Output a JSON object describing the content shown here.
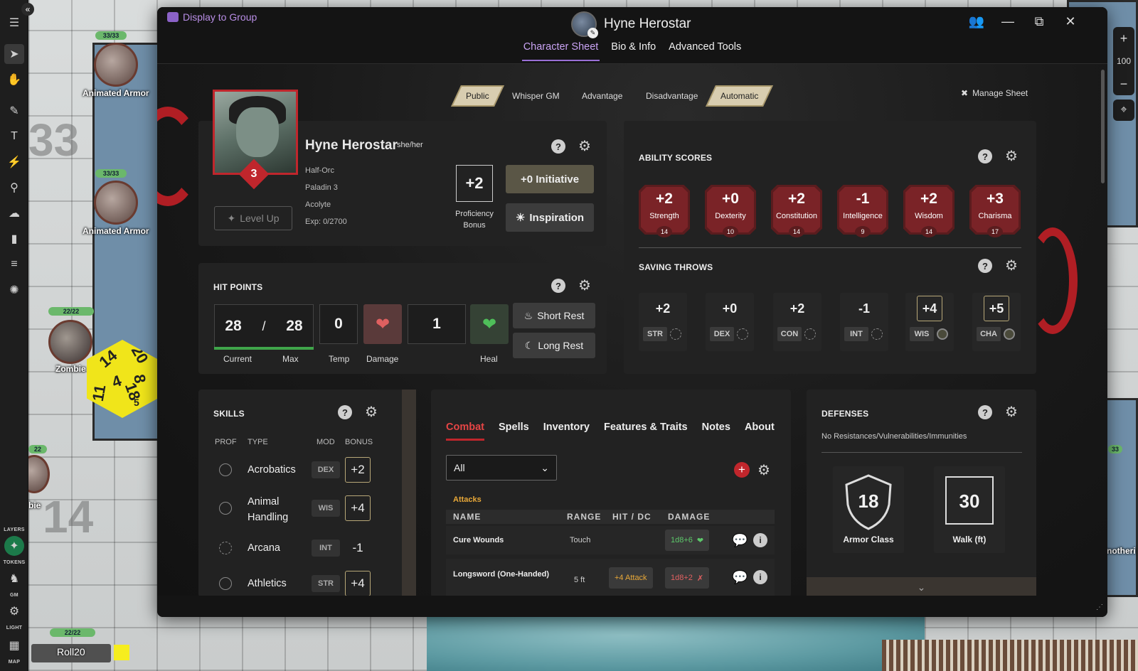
{
  "map": {
    "tokens": [
      {
        "name": "Animated Armor",
        "hp": "33/33"
      },
      {
        "name": "Animated Armor",
        "hp": "33/33"
      },
      {
        "name": "Zombie",
        "hp": "22/22"
      },
      {
        "name": "bie",
        "hp": "22"
      },
      {
        "name": "Roll20",
        "hp": "22/22"
      }
    ],
    "grid_numbers": [
      "33",
      "14"
    ],
    "dice_faces": [
      "14",
      "20",
      "8",
      "18",
      "5",
      "4",
      "11"
    ],
    "right_label": "notheri",
    "right_hp": "33"
  },
  "toolbar": {
    "labels": {
      "layers": "LAYERS",
      "tokens": "TOKENS",
      "gm": "GM",
      "light": "LIGHT",
      "map": "MAP"
    }
  },
  "zoom": {
    "level": "100",
    "plus": "+",
    "minus": "−"
  },
  "player": {
    "name": "Roll20",
    "color": "#f6ed1e"
  },
  "window": {
    "display_to_group": "Display to Group",
    "title": "Hyne Herostar",
    "tabs": [
      "Character Sheet",
      "Bio & Info",
      "Advanced Tools"
    ]
  },
  "roll_options": [
    "Public",
    "Whisper GM",
    "Advantage",
    "Disadvantage",
    "Automatic"
  ],
  "manage_sheet": "Manage Sheet",
  "character": {
    "name": "Hyne Herostar",
    "pronouns": "she/her",
    "race": "Half-Orc",
    "class": "Paladin 3",
    "background": "Acolyte",
    "exp": "Exp: 0/2700",
    "level": "3",
    "level_up": "Level Up",
    "proficiency": "+2",
    "proficiency_label": "Proficiency Bonus",
    "initiative": "+0 Initiative",
    "inspiration": "Inspiration"
  },
  "ability_scores": {
    "title": "ABILITY SCORES",
    "items": [
      {
        "mod": "+2",
        "name": "Strength",
        "score": "14"
      },
      {
        "mod": "+0",
        "name": "Dexterity",
        "score": "10"
      },
      {
        "mod": "+2",
        "name": "Constitution",
        "score": "14"
      },
      {
        "mod": "-1",
        "name": "Intelligence",
        "score": "9"
      },
      {
        "mod": "+2",
        "name": "Wisdom",
        "score": "14"
      },
      {
        "mod": "+3",
        "name": "Charisma",
        "score": "17"
      }
    ]
  },
  "saving_throws": {
    "title": "SAVING THROWS",
    "items": [
      {
        "mod": "+2",
        "abbr": "STR"
      },
      {
        "mod": "+0",
        "abbr": "DEX"
      },
      {
        "mod": "+2",
        "abbr": "CON"
      },
      {
        "mod": "-1",
        "abbr": "INT"
      },
      {
        "mod": "+4",
        "abbr": "WIS"
      },
      {
        "mod": "+5",
        "abbr": "CHA"
      }
    ]
  },
  "hit_points": {
    "title": "HIT POINTS",
    "current": "28",
    "max": "28",
    "slash": "/",
    "temp": "0",
    "amount": "1",
    "labels": {
      "current": "Current",
      "max": "Max",
      "temp": "Temp",
      "damage": "Damage",
      "heal": "Heal"
    },
    "short_rest": "Short Rest",
    "long_rest": "Long Rest"
  },
  "skills": {
    "title": "SKILLS",
    "headers": {
      "prof": "PROF",
      "type": "TYPE",
      "mod": "MOD",
      "bonus": "BONUS"
    },
    "items": [
      {
        "name": "Acrobatics",
        "mod": "DEX",
        "bonus": "+2"
      },
      {
        "name": "Animal Handling",
        "mod": "WIS",
        "bonus": "+4"
      },
      {
        "name": "Arcana",
        "mod": "INT",
        "bonus": "-1"
      },
      {
        "name": "Athletics",
        "mod": "STR",
        "bonus": "+4"
      }
    ]
  },
  "combat": {
    "tabs": [
      "Combat",
      "Spells",
      "Inventory",
      "Features & Traits",
      "Notes",
      "About"
    ],
    "filter": "All",
    "attacks_title": "Attacks",
    "columns": [
      "NAME",
      "RANGE",
      "HIT / DC",
      "DAMAGE"
    ],
    "attacks": [
      {
        "name": "Cure Wounds",
        "range": "Touch",
        "hit": "",
        "damage": "1d8+6"
      },
      {
        "name": "Longsword (One-Handed)",
        "range": "5 ft",
        "hit": "+4 Attack",
        "damage": "1d8+2"
      }
    ]
  },
  "defenses": {
    "title": "DEFENSES",
    "resistances": "No Resistances/Vulnerabilities/Immunities",
    "armor_class": "18",
    "armor_class_label": "Armor Class",
    "walk": "30",
    "walk_label": "Walk (ft)"
  },
  "colors": {
    "accent": "#c0262c",
    "tab_active": "#c9a3f3",
    "heal": "#3fa54a"
  }
}
